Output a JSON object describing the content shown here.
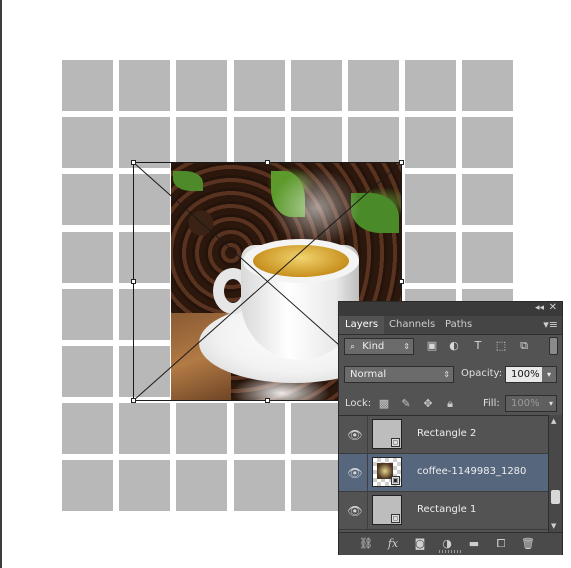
{
  "panel": {
    "tabs": [
      {
        "label": "Layers",
        "active": true
      },
      {
        "label": "Channels",
        "active": false
      },
      {
        "label": "Paths",
        "active": false
      }
    ],
    "collapse_icon": "double-chevron-icon",
    "close_icon": "close-icon",
    "menu_icon": "panel-menu-icon",
    "filter": {
      "search_icon": "search-icon",
      "kind_label": "Kind",
      "filter_icons": [
        "pixel-filter-icon",
        "adjustment-filter-icon",
        "type-filter-icon",
        "shape-filter-icon",
        "smart-object-filter-icon"
      ]
    },
    "blend_mode": "Normal",
    "opacity_label": "Opacity:",
    "opacity_value": "100%",
    "lock_label": "Lock:",
    "lock_icons": [
      "lock-transparent-icon",
      "lock-image-icon",
      "lock-position-icon",
      "lock-all-icon"
    ],
    "fill_label": "Fill:",
    "fill_value": "100%",
    "layers": [
      {
        "name": "Rectangle 2",
        "visible": true,
        "selected": false,
        "thumb": "shape"
      },
      {
        "name": "coffee-1149983_1280",
        "visible": true,
        "selected": true,
        "thumb": "smart-object"
      },
      {
        "name": "Rectangle 1",
        "visible": true,
        "selected": false,
        "thumb": "shape"
      }
    ],
    "bottom_icons": [
      "link-layers-icon",
      "fx-icon",
      "add-mask-icon",
      "adjustment-layer-icon",
      "new-group-icon",
      "new-layer-icon",
      "delete-icon"
    ],
    "colors": {
      "panel_bg": "#535353",
      "selected_row": "#56667d",
      "canvas_tile": "#b8b8b8"
    }
  }
}
